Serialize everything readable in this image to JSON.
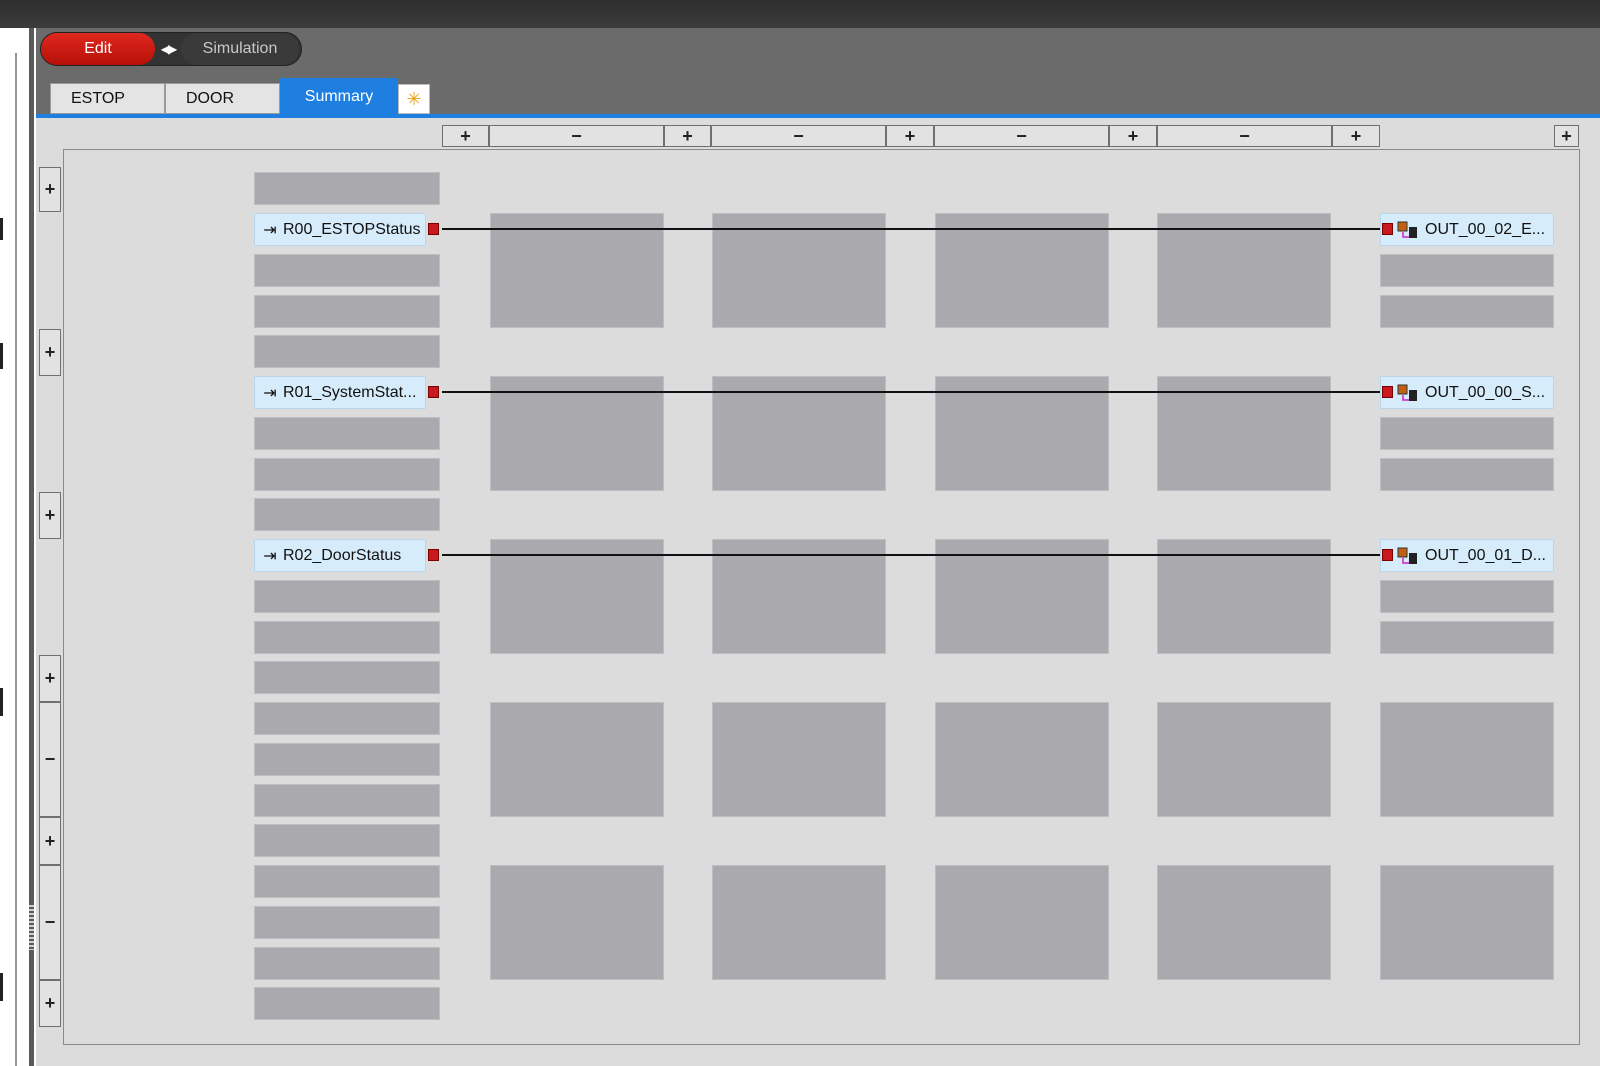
{
  "mode": {
    "edit_label": "Edit",
    "simulation_label": "Simulation",
    "active": "Edit"
  },
  "tabs": [
    {
      "label": "ESTOP"
    },
    {
      "label": "DOOR"
    },
    {
      "label": "Summary",
      "active": true
    }
  ],
  "new_tab_glyph": "✳",
  "toolbar": {
    "column_buttons": [
      "+",
      "−",
      "+",
      "−",
      "+",
      "−",
      "+",
      "−",
      "+",
      "+"
    ],
    "row_buttons": [
      "+",
      "+",
      "+",
      "+",
      "−",
      "+",
      "−",
      "+"
    ]
  },
  "inputs": [
    {
      "label": "R00_ESTOPStatus",
      "icon": "input-arrow-icon"
    },
    {
      "label": "R01_SystemStat...",
      "icon": "input-arrow-icon"
    },
    {
      "label": "R02_DoorStatus",
      "icon": "input-arrow-icon"
    }
  ],
  "outputs": [
    {
      "label": "OUT_00_02_E...",
      "icon": "output-device-icon"
    },
    {
      "label": "OUT_00_00_S...",
      "icon": "output-device-icon"
    },
    {
      "label": "OUT_00_01_D...",
      "icon": "output-device-icon"
    }
  ],
  "colors": {
    "edit_red": "#c8191e",
    "accent_blue": "#1e7fe0",
    "port_red": "#c8191e",
    "slot_gray": "#a9a9ae",
    "node_blue": "#d7ecfa"
  }
}
